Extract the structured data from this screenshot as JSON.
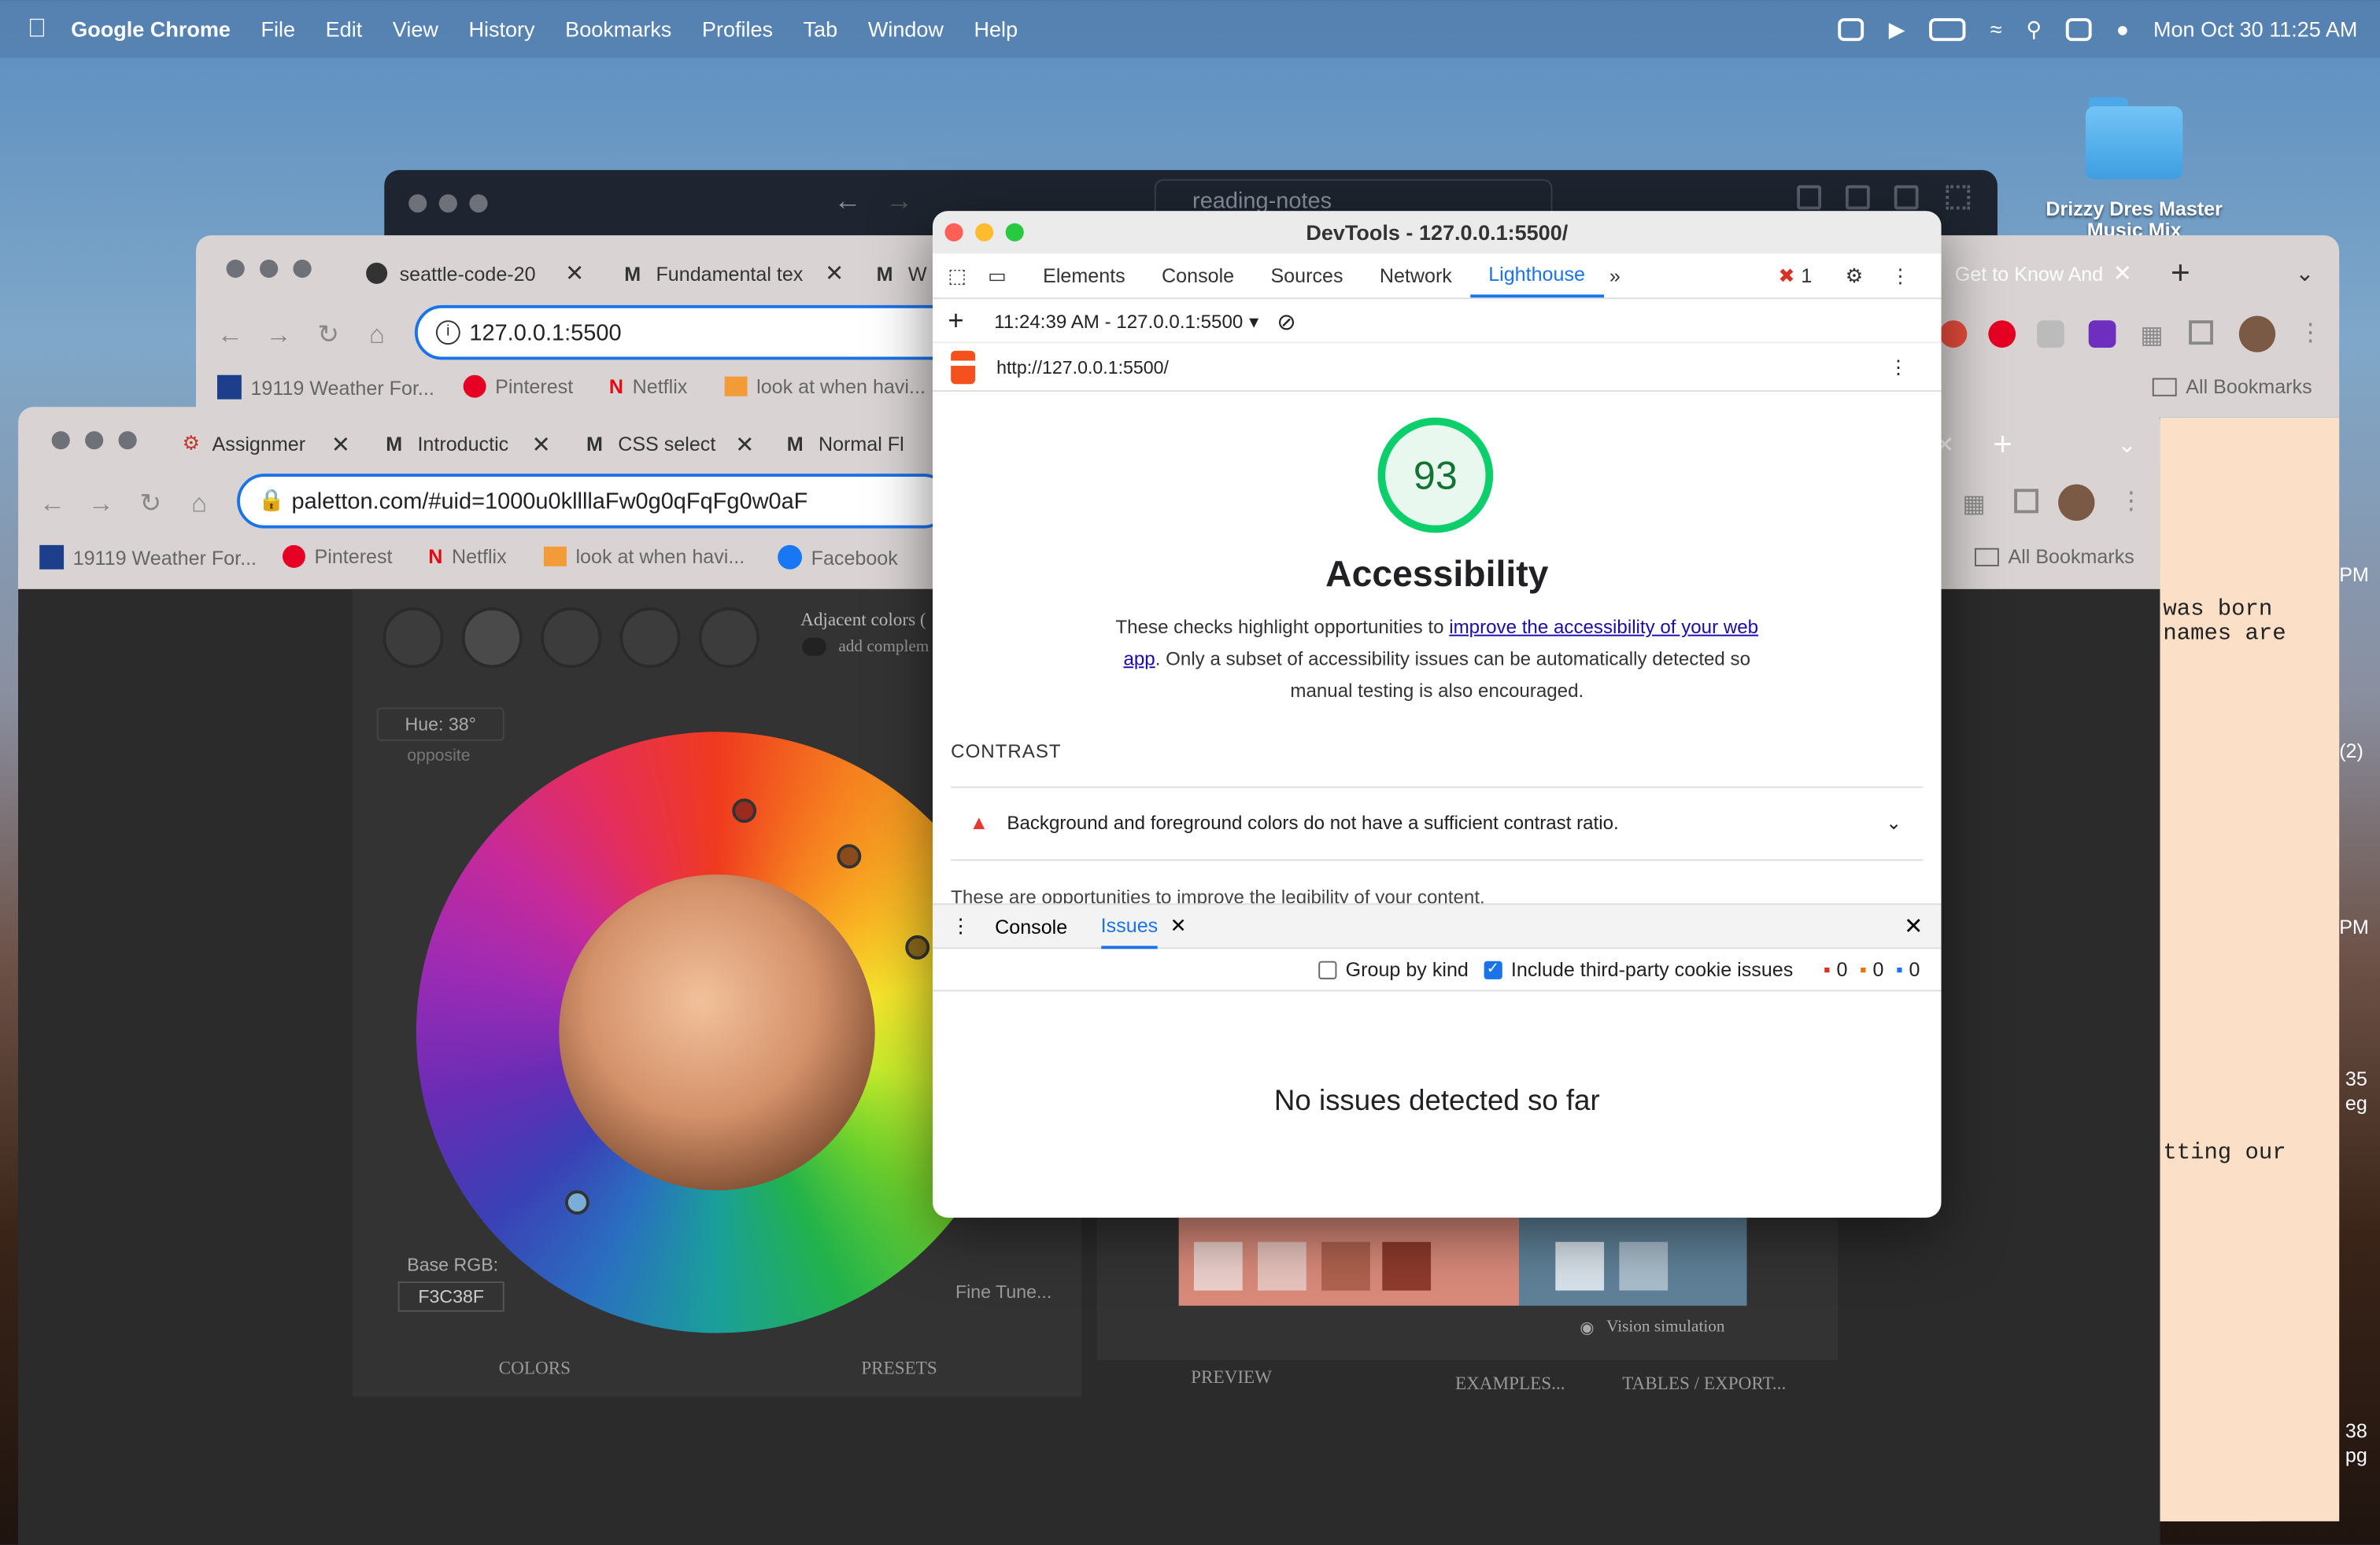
{
  "menubar": {
    "app": "Google Chrome",
    "items": [
      "File",
      "Edit",
      "View",
      "History",
      "Bookmarks",
      "Profiles",
      "Tab",
      "Window",
      "Help"
    ],
    "datetime": "Mon Oct 30  11:25 AM"
  },
  "desktop": {
    "folder_label": "Drizzy Dres Master Music Mix"
  },
  "back_window": {
    "search_text": "reading-notes"
  },
  "window2": {
    "tabs": [
      "seattle-code-20",
      "Fundamental tex",
      "W"
    ],
    "right_tab": "Get to Know And",
    "url": "127.0.0.1:5500",
    "bookmarks": [
      "19119 Weather For...",
      "Pinterest",
      "Netflix",
      "look at when havi..."
    ],
    "all_bookmarks": "All Bookmarks"
  },
  "window3": {
    "tabs": [
      "Assignmer",
      "Introductic",
      "CSS select",
      "Normal Fl"
    ],
    "url": "paletton.com/#uid=1000u0kllllaFw0g0qFqFg0w0aF",
    "bookmarks": [
      "19119 Weather For...",
      "Pinterest",
      "Netflix",
      "look at when havi...",
      "Facebook"
    ],
    "all_bookmarks": "All Bookmarks"
  },
  "paletton": {
    "adjacent": "Adjacent colors (",
    "add_complement": "add complem",
    "hue": "Hue: 38°",
    "opposite": "opposite",
    "base_rgb_label": "Base RGB:",
    "base_rgb": "F3C38F",
    "fine_tune": "Fine Tune...",
    "bottom_tabs": [
      "COLORS",
      "PRESETS"
    ],
    "preview": "PREVIEW",
    "vision": "Vision simulation",
    "examples": "EXAMPLES...",
    "tables": "TABLES / EXPORT...",
    "colors": {
      "swatch1": "#ecd0cc",
      "swatch2": "#e8c3bd",
      "swatch3": "#b0624f",
      "swatch4": "#8e3b2c",
      "panel": "#d98a7a",
      "blue": "#5f8198"
    }
  },
  "devtools": {
    "title": "DevTools - 127.0.0.1:5500/",
    "tabs": [
      "Elements",
      "Console",
      "Sources",
      "Network",
      "Lighthouse"
    ],
    "error_count": "1",
    "report_time": "11:24:39 AM - 127.0.0.1:5500",
    "report_url": "http://127.0.0.1:5500/",
    "score": "93",
    "category": "Accessibility",
    "desc_before": "These checks highlight opportunities to ",
    "desc_link": "improve the accessibility of your web app",
    "desc_after": ". Only a subset of accessibility issues can be automatically detected so manual testing is also encouraged.",
    "section": "CONTRAST",
    "audit": "Background and foreground colors do not have a sufficient contrast ratio.",
    "opportunity": "These are opportunities to improve the legibility of your content.",
    "drawer_tabs": [
      "Console",
      "Issues"
    ],
    "group_by_kind": "Group by kind",
    "include_third_party": "Include third-party cookie issues",
    "counts": [
      "0",
      "0",
      "0"
    ],
    "no_issues": "No issues detected so far"
  },
  "doc_fragments": [
    "was born",
    "names are",
    "tting our"
  ],
  "doc_edge": [
    "PM",
    "(2)",
    "PM",
    "35",
    "eg",
    "38",
    "pg"
  ]
}
